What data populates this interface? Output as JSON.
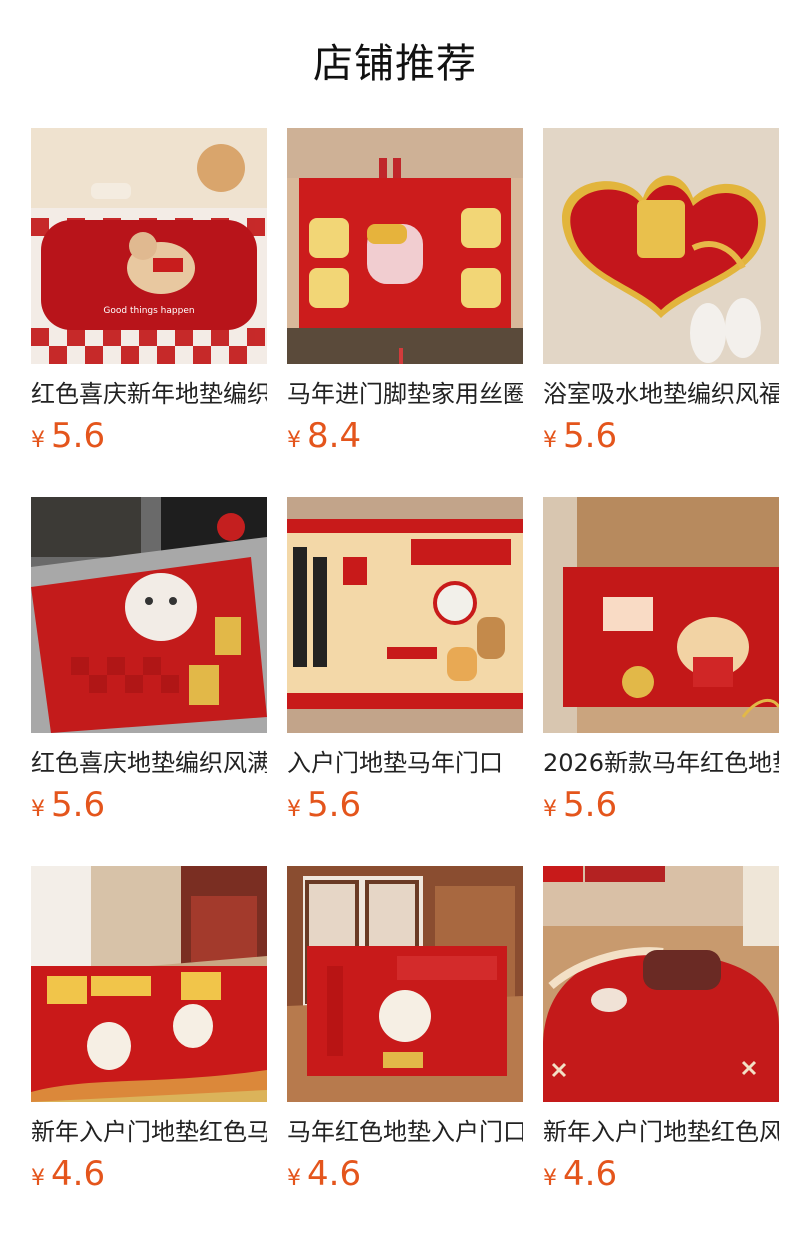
{
  "header": {
    "title": "店铺推荐"
  },
  "products": [
    {
      "name": "红色喜庆新年地垫编织风",
      "currency": "¥",
      "price": "5.6",
      "image": "red-horse-mat-checkered-floor"
    },
    {
      "name": "马年进门脚垫家用丝圈",
      "currency": "¥",
      "price": "8.4",
      "image": "red-coil-mat-fortune-characters"
    },
    {
      "name": "浴室吸水地垫编织风福字",
      "currency": "¥",
      "price": "5.6",
      "image": "cloud-shaped-fu-mat"
    },
    {
      "name": "红色喜庆地垫编织风满满",
      "currency": "¥",
      "price": "5.6",
      "image": "red-checker-lucky-cat-mat"
    },
    {
      "name": "入户门地垫马年门口",
      "currency": "¥",
      "price": "5.6",
      "image": "fortune-calligraphy-horse-mat"
    },
    {
      "name": "2026新款马年红色地垫",
      "currency": "¥",
      "price": "5.6",
      "image": "red-horse-yi-ma-dang-xian-mat"
    },
    {
      "name": "新年入户门地垫红色马上暴富",
      "currency": "¥",
      "price": "4.6",
      "image": "red-horse-ma-shang-bao-fu-mat"
    },
    {
      "name": "马年红色地垫入户门口",
      "currency": "¥",
      "price": "4.6",
      "image": "red-entry-door-horse-mat"
    },
    {
      "name": "新年入户门地垫红色风",
      "currency": "¥",
      "price": "4.6",
      "image": "welcome-apple-horse-mat"
    }
  ]
}
